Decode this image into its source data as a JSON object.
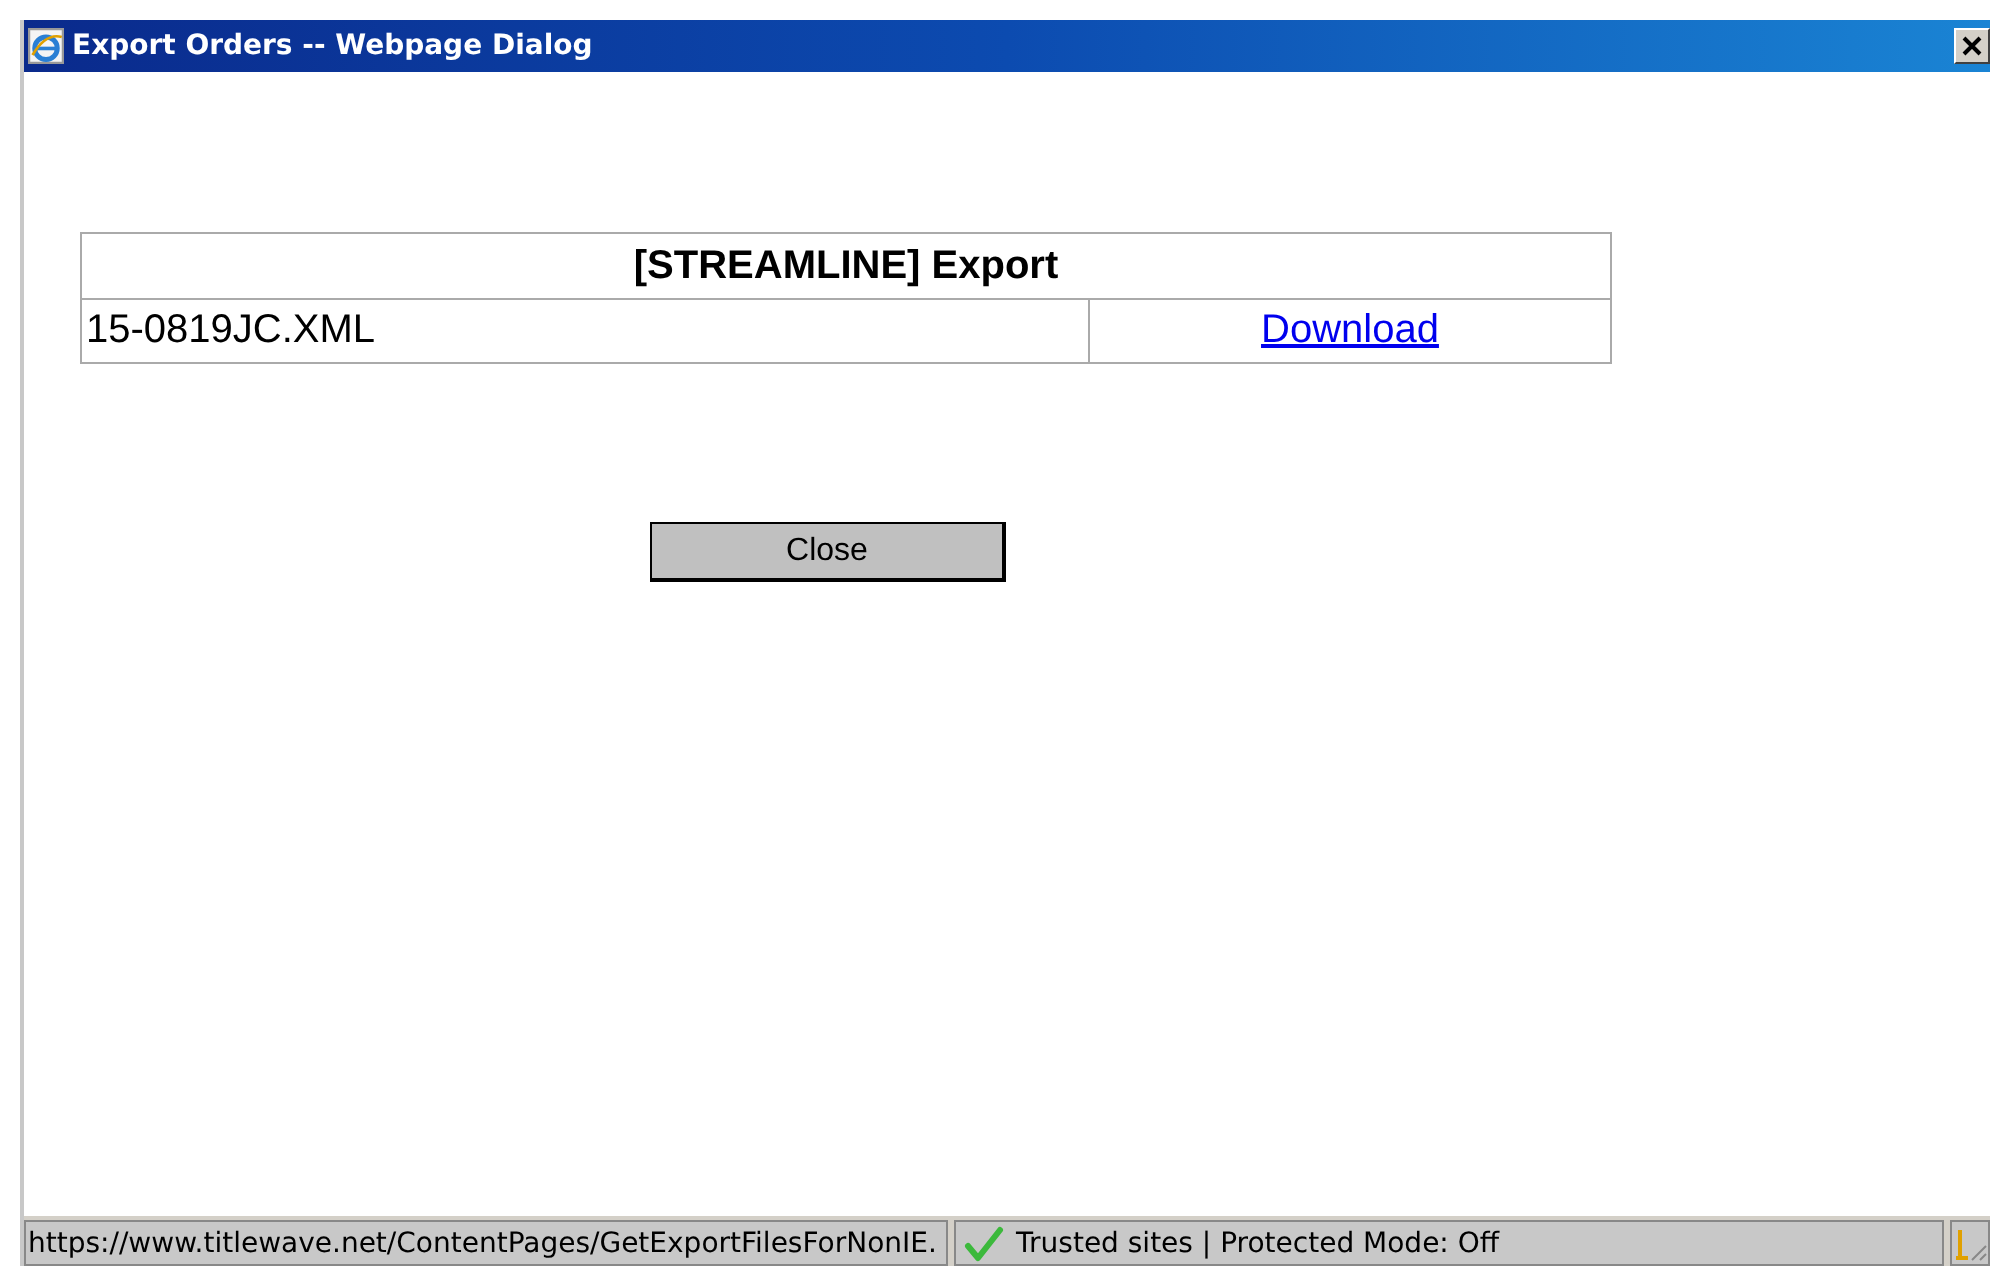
{
  "window": {
    "title": "Export Orders -- Webpage Dialog"
  },
  "table": {
    "heading": "[STREAMLINE] Export",
    "rows": [
      {
        "file": "15-0819JC.XML",
        "link": "Download"
      }
    ]
  },
  "buttons": [
    "Close"
  ],
  "status_bar": {
    "url": "https://www.titlewave.net/ContentPages/GetExportFilesForNonIE.",
    "zone": "Trusted sites | Protected Mode: Off"
  }
}
